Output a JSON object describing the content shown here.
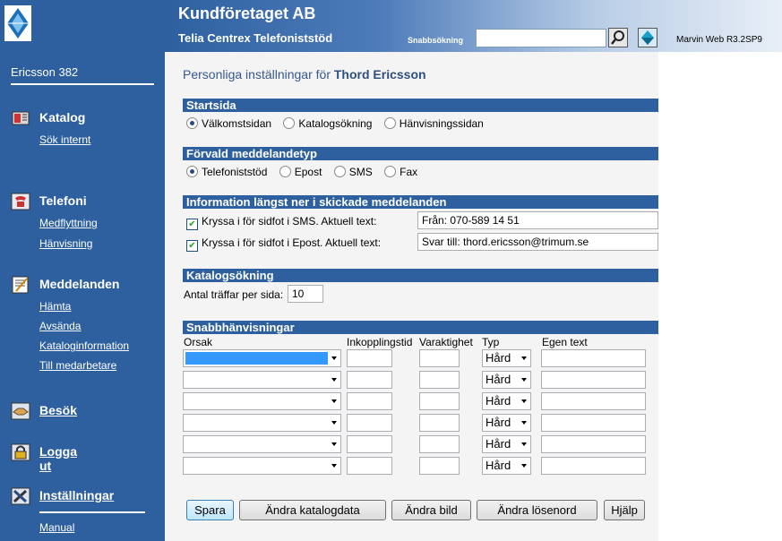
{
  "header": {
    "title": "Kundföretaget AB",
    "subtitle": "Telia Centrex Telefoniststöd",
    "quicksearch_label": "Snabbsökning",
    "quicksearch_value": "",
    "version": "Marvin Web R3.2SP9"
  },
  "sidebar": {
    "user": "Ericsson 382",
    "groups": [
      {
        "label": "Katalog",
        "links": [
          "Sök internt"
        ]
      },
      {
        "label": "Telefoni",
        "links": [
          "Medflyttning",
          "Hänvisning"
        ]
      },
      {
        "label": "Meddelanden",
        "links": [
          "Hämta",
          "Avsända",
          "Kataloginformation",
          "Till medarbetare"
        ]
      },
      {
        "label": "Besök",
        "links": []
      },
      {
        "label": "Logga ut",
        "links": []
      },
      {
        "label": "Inställningar",
        "links": [
          "Manual"
        ]
      }
    ]
  },
  "main": {
    "title_prefix": "Personliga inställningar för",
    "title_name": "Thord Ericsson",
    "startsida": {
      "heading": "Startsida",
      "options": [
        "Välkomstsidan",
        "Katalogsökning",
        "Hänvisningssidan"
      ],
      "selected": 0
    },
    "meddelandetyp": {
      "heading": "Förvald meddelandetyp",
      "options": [
        "Telefoniststöd",
        "Epost",
        "SMS",
        "Fax"
      ],
      "selected": 0
    },
    "footer_info": {
      "heading": "Information längst ner i skickade meddelanden",
      "sms_label": "Kryssa i för sidfot i SMS. Aktuell text:",
      "sms_checked": true,
      "sms_value": "Från: 070-589 14 51",
      "epost_label": "Kryssa i för sidfot i Epost. Aktuell text:",
      "epost_checked": true,
      "epost_value": "Svar till: thord.ericsson@trimum.se"
    },
    "katalogsokning": {
      "heading": "Katalogsökning",
      "hits_label": "Antal träffar per sida:",
      "hits_value": "10"
    },
    "snabbhanvisningar": {
      "heading": "Snabbhänvisningar",
      "columns": [
        "Orsak",
        "Inkopplingstid",
        "Varaktighet",
        "Typ",
        "Egen text"
      ],
      "rows": [
        {
          "typ": "Hård"
        },
        {
          "typ": "Hård"
        },
        {
          "typ": "Hård"
        },
        {
          "typ": "Hård"
        },
        {
          "typ": "Hård"
        },
        {
          "typ": "Hård"
        }
      ]
    },
    "buttons": {
      "save": "Spara",
      "edit_catalog": "Ändra katalogdata",
      "edit_image": "Ändra bild",
      "edit_password": "Ändra lösenord",
      "help": "Hjälp"
    }
  },
  "colors": {
    "sidebar": "#2e609f",
    "section_header": "#2e609f"
  }
}
